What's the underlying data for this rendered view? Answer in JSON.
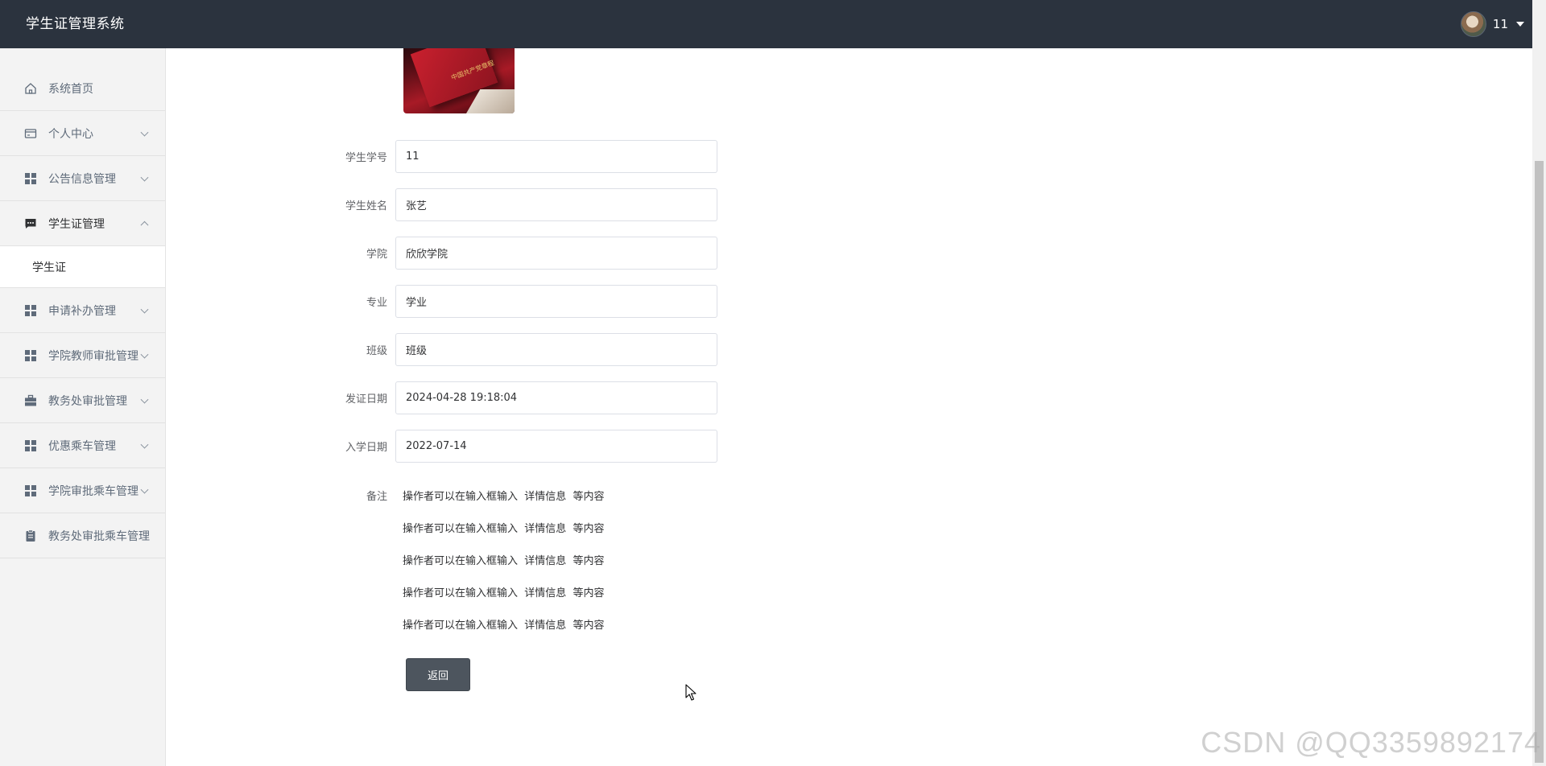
{
  "header": {
    "app_title": "学生证管理系统",
    "user_name": "11",
    "bg_color": "#2b333e"
  },
  "sidebar": {
    "items": [
      {
        "label": "系统首页",
        "icon": "home-icon",
        "expandable": false
      },
      {
        "label": "个人中心",
        "icon": "card-icon",
        "expandable": true
      },
      {
        "label": "公告信息管理",
        "icon": "grid-icon",
        "expandable": true
      },
      {
        "label": "学生证管理",
        "icon": "chat-icon",
        "expandable": true,
        "expanded": true,
        "children": [
          {
            "label": "学生证"
          }
        ]
      },
      {
        "label": "申请补办管理",
        "icon": "grid-icon",
        "expandable": true
      },
      {
        "label": "学院教师审批管理",
        "icon": "grid-icon",
        "expandable": true
      },
      {
        "label": "教务处审批管理",
        "icon": "briefcase-icon",
        "expandable": true
      },
      {
        "label": "优惠乘车管理",
        "icon": "grid-icon",
        "expandable": true
      },
      {
        "label": "学院审批乘车管理",
        "icon": "grid-icon",
        "expandable": true
      },
      {
        "label": "教务处审批乘车管理",
        "icon": "clipboard-icon",
        "expandable": false
      }
    ]
  },
  "photo": {
    "stamp_text": "中国共产党章程"
  },
  "form": {
    "fields": [
      {
        "label": "学生学号",
        "value": "11"
      },
      {
        "label": "学生姓名",
        "value": "张艺"
      },
      {
        "label": "学院",
        "value": "欣欣学院"
      },
      {
        "label": "专业",
        "value": "学业"
      },
      {
        "label": "班级",
        "value": "班级"
      },
      {
        "label": "发证日期",
        "value": "2024-04-28 19:18:04"
      },
      {
        "label": "入学日期",
        "value": "2022-07-14"
      }
    ],
    "remark_label": "备注",
    "remark_lines": [
      "操作者可以在输入框输入  详情信息  等内容",
      "操作者可以在输入框输入  详情信息  等内容",
      "操作者可以在输入框输入  详情信息  等内容",
      "操作者可以在输入框输入  详情信息  等内容",
      "操作者可以在输入框输入  详情信息  等内容"
    ],
    "back_label": "返回"
  },
  "watermark": "CSDN @QQ3359892174"
}
